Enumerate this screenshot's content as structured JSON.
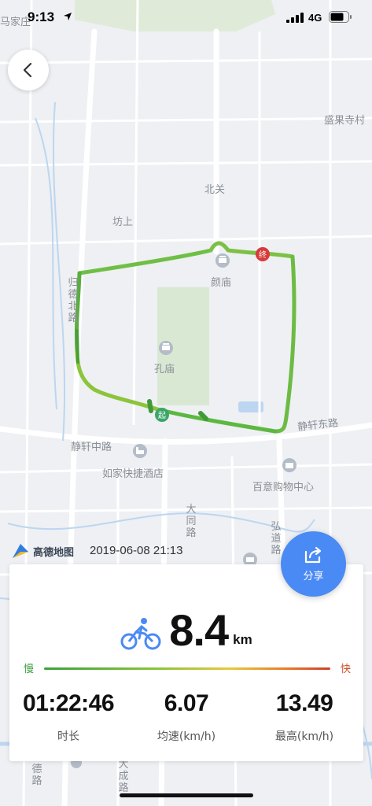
{
  "status_bar": {
    "time": "9:13",
    "network": "4G"
  },
  "map": {
    "labels": {
      "majiazhuang": "马家庄",
      "shengguosicun": "盛果寺村",
      "beiguan": "北关",
      "fangshang": "坊上",
      "yanmiao": "颜庙",
      "kongmiao": "孔庙",
      "jingxuandonglu": "静轩东路",
      "jingxuanzhonglu": "静轩中路",
      "rujia": "如家快捷酒店",
      "baiyi": "百意购物中心",
      "guidebeilu": "归德北路",
      "datonglu": "大同路",
      "hongdaolu": "弘道路",
      "bottom_road_left": "德路",
      "bottom_road_mid": "大成路"
    },
    "markers": {
      "start": "起",
      "end": "终"
    }
  },
  "watermark": {
    "brand": "高德地图",
    "timestamp": "2019-06-08 21:13"
  },
  "share": {
    "label": "分享"
  },
  "stats": {
    "distance": "8.4",
    "distance_unit": "km",
    "slow_label": "慢",
    "fast_label": "快",
    "duration": {
      "value": "01:22:46",
      "label": "时长"
    },
    "avg_speed": {
      "value": "6.07",
      "label": "均速(km/h)"
    },
    "max_speed": {
      "value": "13.49",
      "label": "最高(km/h)"
    }
  },
  "colors": {
    "route_green": "#5cb840",
    "share_blue": "#4a8af5",
    "start_marker": "#3aa56a",
    "end_marker": "#d83a3a"
  }
}
